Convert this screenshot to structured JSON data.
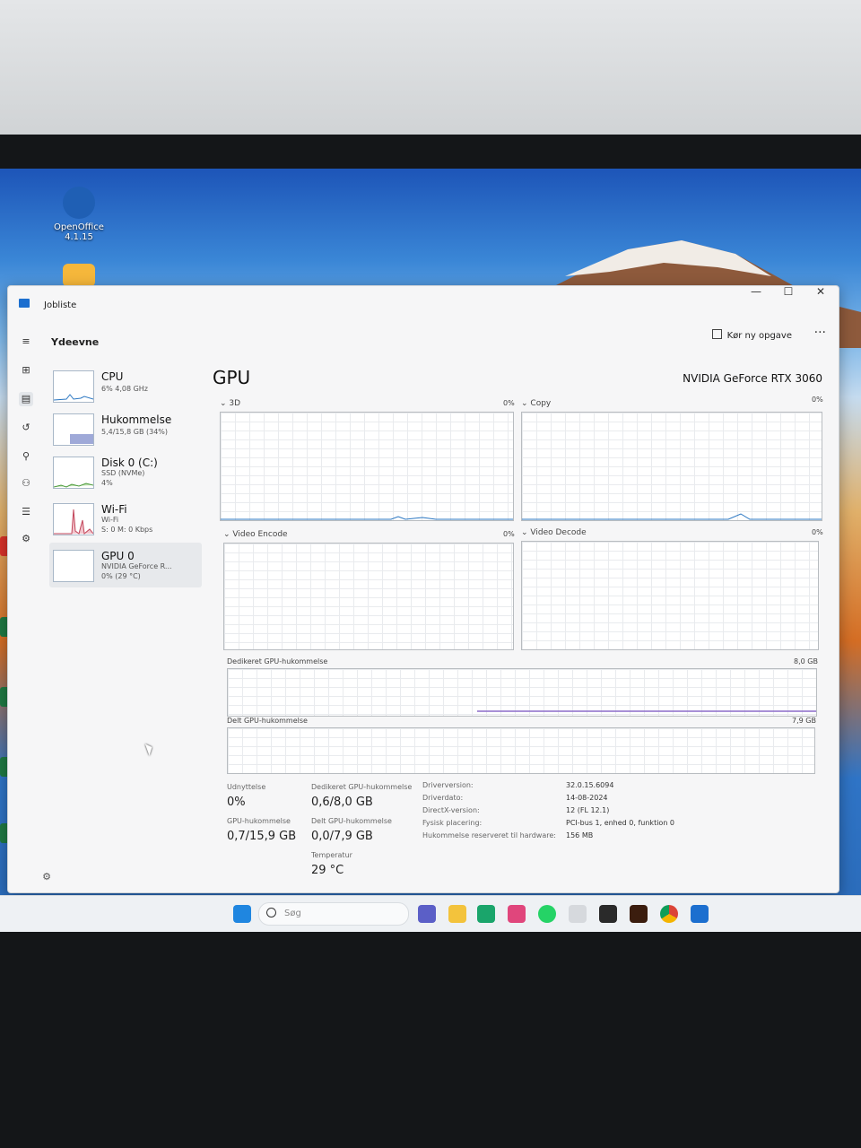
{
  "desktop": {
    "icons": [
      {
        "name": "OpenOffice 4.1.15"
      }
    ]
  },
  "window": {
    "app_title": "Jobliste",
    "controls": {
      "minimize": "—",
      "maximize": "☐",
      "close": "✕"
    }
  },
  "header": {
    "title": "Ydeevne",
    "run_task": "Kør ny opgave",
    "more": "···"
  },
  "sidebar": {
    "items": [
      {
        "name": "CPU",
        "sub1": "6% 4,08 GHz",
        "sub2": "",
        "sub3": ""
      },
      {
        "name": "Hukommelse",
        "sub1": "5,4/15,8 GB (34%)",
        "sub2": "",
        "sub3": ""
      },
      {
        "name": "Disk 0 (C:)",
        "sub1": "SSD (NVMe)",
        "sub2": "4%",
        "sub3": ""
      },
      {
        "name": "Wi-Fi",
        "sub1": "Wi-Fi",
        "sub2": "S: 0 M: 0 Kbps",
        "sub3": ""
      },
      {
        "name": "GPU 0",
        "sub1": "NVIDIA GeForce R...",
        "sub2": "0% (29 °C)",
        "sub3": ""
      }
    ],
    "selected_index": 4
  },
  "main": {
    "title": "GPU",
    "model": "NVIDIA GeForce RTX 3060",
    "graphs": {
      "g3d": {
        "label": "3D",
        "pct": "0%"
      },
      "copy": {
        "label": "Copy",
        "pct": "0%"
      },
      "encode": {
        "label": "Video Encode",
        "pct": "0%"
      },
      "decode": {
        "label": "Video Decode",
        "pct": "0%"
      },
      "dedicated": {
        "label": "Dedikeret GPU-hukommelse",
        "max": "8,0 GB"
      },
      "shared": {
        "label": "Delt GPU-hukommelse",
        "max": "7,9 GB"
      }
    },
    "stats": {
      "utilization_label": "Udnyttelse",
      "utilization_value": "0%",
      "gpu_memory_label": "GPU-hukommelse",
      "gpu_memory_value": "0,7/15,9 GB",
      "dedicated_label": "Dedikeret GPU-hukommelse",
      "dedicated_value": "0,6/8,0 GB",
      "shared_label": "Delt GPU-hukommelse",
      "shared_value": "0,0/7,9 GB",
      "temp_label": "Temperatur",
      "temp_value": "29 °C",
      "details": [
        {
          "label": "Driverversion:",
          "value": "32.0.15.6094"
        },
        {
          "label": "Driverdato:",
          "value": "14-08-2024"
        },
        {
          "label": "DirectX-version:",
          "value": "12 (FL 12.1)"
        },
        {
          "label": "Fysisk placering:",
          "value": "PCI-bus 1, enhed 0, funktion 0"
        },
        {
          "label": "Hukommelse reserveret til hardware:",
          "value": "156 MB"
        }
      ]
    }
  },
  "taskbar": {
    "search_placeholder": "Søg"
  },
  "colors": {
    "accent": "#1c6fcf",
    "memory_line": "#8b6cc8",
    "wifi_graph": "#c2455a",
    "disk_graph": "#4a9a3a"
  }
}
